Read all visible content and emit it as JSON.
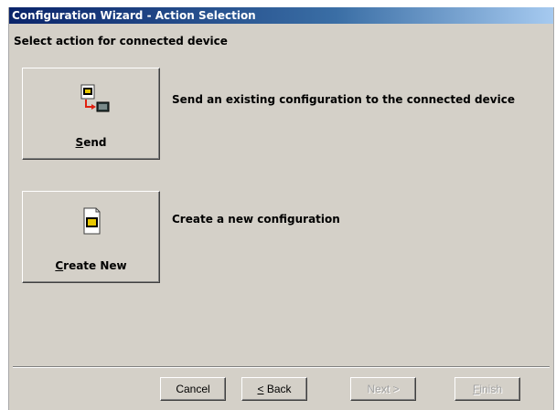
{
  "window": {
    "title": "Configuration Wizard - Action Selection"
  },
  "heading": "Select action for connected device",
  "actions": [
    {
      "label_underline": "S",
      "label_rest": "end",
      "description": "Send an existing configuration to the connected device",
      "icon": "send-config-icon"
    },
    {
      "label_underline": "C",
      "label_rest": "reate New",
      "description": "Create a new configuration",
      "icon": "new-config-icon"
    }
  ],
  "buttons": {
    "cancel": "Cancel",
    "back_underline": "<",
    "back_rest": " Back",
    "next_underline": "N",
    "next_rest": "ext >",
    "finish_underline": "F",
    "finish_rest": "inish"
  },
  "colors": {
    "titlebar_start": "#0a246a",
    "titlebar_end": "#a6caf0",
    "face": "#d4d0c8",
    "arrow": "#e02010",
    "chip": "#e8c800"
  }
}
